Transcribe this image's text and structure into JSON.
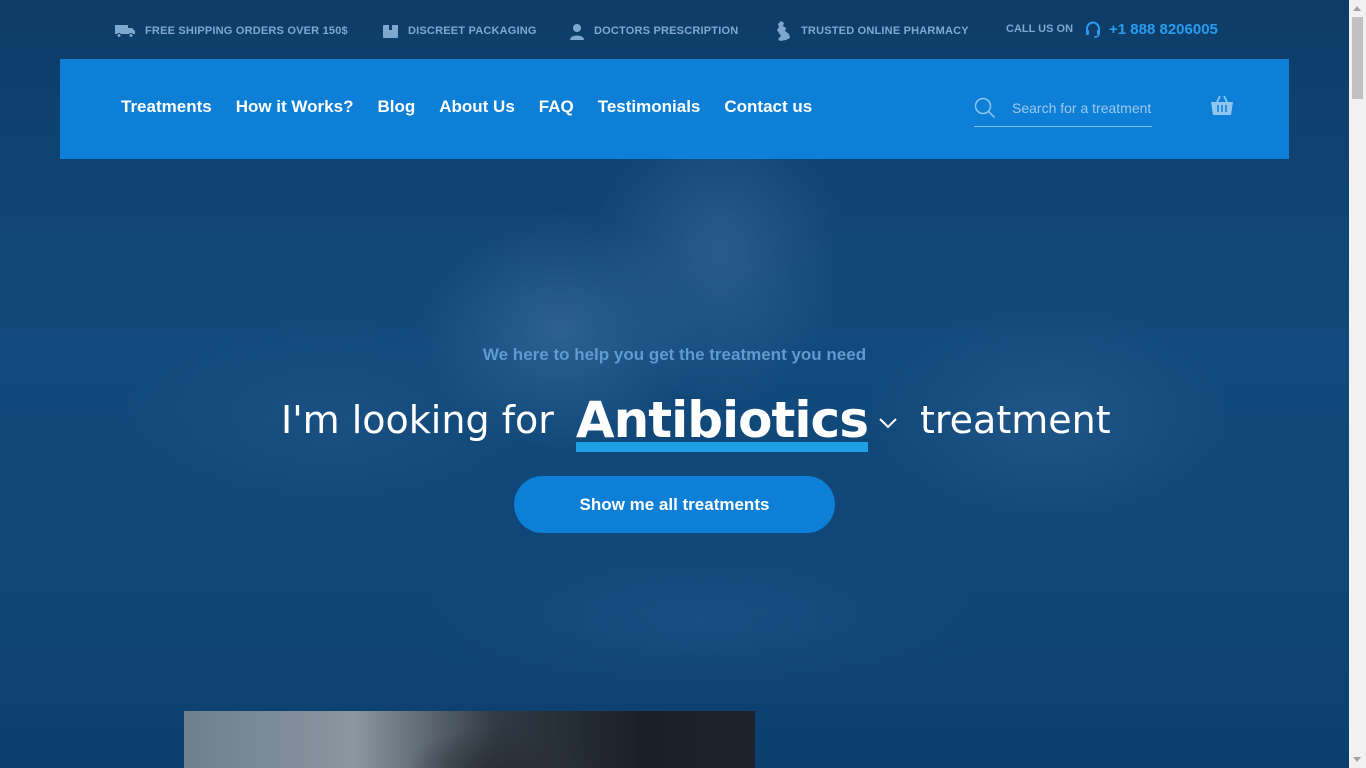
{
  "topbar": {
    "items": [
      {
        "icon": "truck-icon",
        "label": "FREE SHIPPING ORDERS OVER 150$"
      },
      {
        "icon": "package-icon",
        "label": "DISCREET PACKAGING"
      },
      {
        "icon": "doctor-icon",
        "label": "DOCTORS PRESCRIPTION"
      },
      {
        "icon": "uk-map-icon",
        "label": "TRUSTED ONLINE PHARMACY"
      }
    ],
    "call_label": "CALL US ON",
    "phone": "+1 888 8206005",
    "phone_icon": "headset-icon"
  },
  "nav": {
    "items": [
      {
        "label": "Treatments"
      },
      {
        "label": "How it Works?"
      },
      {
        "label": "Blog"
      },
      {
        "label": "About Us"
      },
      {
        "label": "FAQ"
      },
      {
        "label": "Testimonials"
      },
      {
        "label": "Contact us"
      }
    ],
    "search_placeholder": "Search for a treatment",
    "cart_icon": "basket-icon"
  },
  "hero": {
    "tagline": "We here to help you get the treatment you need",
    "looking_prefix": "I'm looking for",
    "selected_treatment": "Antibiotics",
    "looking_suffix": "treatment",
    "cta_label": "Show me all treatments"
  },
  "colors": {
    "nav_bg": "#0d7fd6",
    "accent": "#1fa0e6",
    "phone": "#2a9cf0",
    "hero_bg": "#0e3c68"
  }
}
